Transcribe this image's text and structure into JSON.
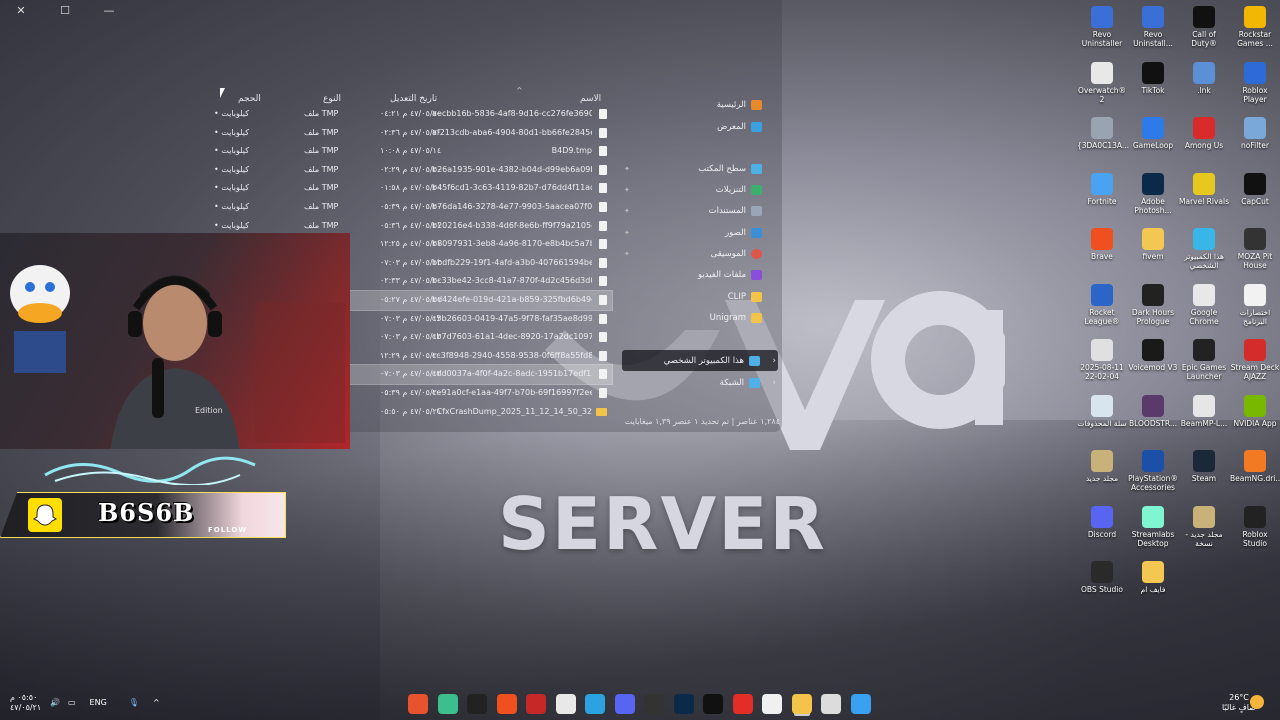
{
  "wallpaper": {
    "server_text": "SERVER"
  },
  "window": {
    "title_buttons": [
      "✕",
      "☐",
      "—"
    ],
    "columns": {
      "size": "الحجم",
      "type": "النوع",
      "date": "تاريخ التعديل",
      "name": "الاسم"
    },
    "files": [
      {
        "size": "• كيلوبايت",
        "type": "ملف TMP",
        "date": "٤٧/٠٥/٢٠ م ٠٤:٢١",
        "name": "aecbb16b-5836-4af8-9d16-cc276fe36900",
        "icon": "file",
        "selected": false
      },
      {
        "size": "• كيلوبايت",
        "type": "ملف TMP",
        "date": "٤٧/٠٥/٢٠ م ٠٢:٣٦",
        "name": "af213cdb-aba6-4904-80d1-bb66fe2845e9....",
        "icon": "file",
        "selected": false
      },
      {
        "size": "• كيلوبايت",
        "type": "ملف TMP",
        "date": "٤٧/٠٥/١٤ م ١٠:٠٨",
        "name": "B4D9.tmp",
        "icon": "file",
        "selected": false
      },
      {
        "size": "• كيلوبايت",
        "type": "ملف TMP",
        "date": "٤٧/٠٥/٢٠ م ٠٢:٢٩",
        "name": "b26a1935-901e-4382-b04d-d99eb6a09b3...",
        "icon": "file",
        "selected": false
      },
      {
        "size": "• كيلوبايت",
        "type": "ملف TMP",
        "date": "٤٧/٠٥/٢٠ م ٠١:٥٨",
        "name": "b45f6cd1-3c63-4119-82b7-d76dd4f11ade...",
        "icon": "file",
        "selected": false
      },
      {
        "size": "• كيلوبايت",
        "type": "ملف TMP",
        "date": "٤٧/٠٥/٢٠ م ٠٥:٣٩",
        "name": "b76da146-3278-4e77-9903-5aacea07f07b...",
        "icon": "file",
        "selected": false
      },
      {
        "size": "• كيلوبايت",
        "type": "ملف TMP",
        "date": "٤٧/٠٥/٢١ م ٠٥:٣٦",
        "name": "b20216e4-b338-4d6f-8e6b-ff9f79a21054.t...",
        "icon": "file",
        "selected": false
      },
      {
        "size": "",
        "type": "",
        "date": "٤٧/٠٥/٢١ م ١٢:٢٥",
        "name": "b8097931-3eb8-4a96-8170-e8b4bc5a7b2...",
        "icon": "file",
        "selected": false
      },
      {
        "size": "",
        "type": "",
        "date": "٤٧/٠٥/١٣ م ٠٧:٠٣",
        "name": "bbdfb229-19f1-4afd-a3b0-407661594be4...",
        "icon": "file",
        "selected": false
      },
      {
        "size": "",
        "type": "",
        "date": "٤٧/٠٥/٢٠ م ٠٢:٣٣",
        "name": "bc33be42-3cc8-41a7-870f-4d2c456d3d01...",
        "icon": "file",
        "selected": false
      },
      {
        "size": "",
        "type": "",
        "date": "٤٧/٠٥/٢١ م ٠٥:٢٧",
        "name": "bd424efe-019d-421a-b859-325fbd6b49c0...",
        "icon": "file",
        "selected": true
      },
      {
        "size": "",
        "type": "",
        "date": "٤٧/٠٥/١٣ م ٠٧:٠٣",
        "name": "c5b26603-0419-47a5-9f78-faf35ae8d996.t...",
        "icon": "file",
        "selected": false
      },
      {
        "size": "",
        "type": "",
        "date": "٤٧/٠٥/١٣ م ٠٧:٠٣",
        "name": "cb7d7603-61a1-4dec-8920-17a2dc109785...",
        "icon": "file",
        "selected": false
      },
      {
        "size": "",
        "type": "",
        "date": "٤٧/٠٥/٢٠ م ١٢:٢٩",
        "name": "cc3f8948-2940-4558-9538-0f6ff8a55fd8.t...",
        "icon": "file",
        "selected": false
      },
      {
        "size": "",
        "type": "",
        "date": "٤٧/٠٥/١٣ م ٠٧:٠٣",
        "name": "cdd0037a-4f0f-4a2c-8adc-1951b17edf13....",
        "icon": "file",
        "selected": true
      },
      {
        "size": "",
        "type": "",
        "date": "٤٧/٠٥/٢٠ م ٠٥:٣٩",
        "name": "ce91a0cf-e1aa-49f7-b70b-69f16997f2ee.t...",
        "icon": "file",
        "selected": false
      },
      {
        "size": "",
        "type": "",
        "date": "٤٧/٠٥/٢١ م ٠٥:٥٠",
        "name": "CfxCrashDump_2025_11_12_14_50_32",
        "icon": "folder",
        "selected": false
      }
    ],
    "nav": {
      "home": "الرئيسية",
      "gallery": "المعرض",
      "desktop": "سطح المكتب",
      "downloads": "التنزيلات",
      "documents": "المستندات",
      "pictures": "الصور",
      "music": "الموسيقى",
      "videos": "ملفات الفيديو",
      "clip": "CLIP",
      "unigram": "Unigram",
      "this_pc": "هذا الكمبيوتر الشخصي",
      "network": "الشبكة"
    },
    "status": "١,٢٨٤ عناصر  |  تم تحديد ١ عنصر ١,٣٩ ميغابايت"
  },
  "overlay": {
    "webcam_shirt": "Edition",
    "snap_handle": "B6S6B",
    "follow_label": "FOLLOW"
  },
  "desktop_icons": [
    {
      "label": "Revo Uninstaller",
      "color": "#3a6fd8"
    },
    {
      "label": "Revo Uninstall...",
      "color": "#3a6fd8"
    },
    {
      "label": "Call of Duty®",
      "color": "#111111"
    },
    {
      "label": "Rockstar Games ...",
      "color": "#f2b705"
    },
    {
      "label": "Overwatch® 2",
      "color": "#e8e8e8"
    },
    {
      "label": "TikTok",
      "color": "#111111"
    },
    {
      "label": ".lnk",
      "color": "#5b8fd6"
    },
    {
      "label": "Roblox Player",
      "color": "#2f6bd8"
    },
    {
      "label": "{3DA0C13A...",
      "color": "#9aa4b0"
    },
    {
      "label": "GameLoop",
      "color": "#2d7be8"
    },
    {
      "label": "Among Us",
      "color": "#d92b2b"
    },
    {
      "label": "noFilter",
      "color": "#7aa8d8"
    },
    {
      "label": "Fortnite",
      "color": "#4aa3f0"
    },
    {
      "label": "Adobe Photosh...",
      "color": "#0b2a4a"
    },
    {
      "label": "Marvel Rivals",
      "color": "#e6c81e"
    },
    {
      "label": "CapCut",
      "color": "#111111"
    },
    {
      "label": "Brave",
      "color": "#f04f1f"
    },
    {
      "label": "fivem",
      "color": "#f4c752"
    },
    {
      "label": "هذا الكمبيوتر الشخصي",
      "color": "#38b6e8"
    },
    {
      "label": "MOZA Pit House",
      "color": "#333333"
    },
    {
      "label": "Rocket League®",
      "color": "#2b65c8"
    },
    {
      "label": "Dark Hours Prologue",
      "color": "#222222"
    },
    {
      "label": "Google Chrome",
      "color": "#e8e8e8"
    },
    {
      "label": "اختصارات البرنامج",
      "color": "#f2f2f2"
    },
    {
      "label": "2025-08-11 22-02-04",
      "color": "#e0e0e0"
    },
    {
      "label": "Voicemod V3",
      "color": "#1a1a1a"
    },
    {
      "label": "Epic Games Launcher",
      "color": "#222222"
    },
    {
      "label": "Stream Deck AJAZZ",
      "color": "#d42b2b"
    },
    {
      "label": "سلة المحذوفات",
      "color": "#d8e4ee"
    },
    {
      "label": "BLOODSTR...",
      "color": "#5a3a6a"
    },
    {
      "label": "BeamMP-L...",
      "color": "#e6e6e6"
    },
    {
      "label": "NVIDIA App",
      "color": "#77b900"
    },
    {
      "label": "مجلد جديد",
      "color": "#c9b27a"
    },
    {
      "label": "PlayStation® Accessories",
      "color": "#1b4fa8"
    },
    {
      "label": "Steam",
      "color": "#1b2838"
    },
    {
      "label": "BeamNG.dri...",
      "color": "#f27a22"
    },
    {
      "label": "Discord",
      "color": "#5865f2"
    },
    {
      "label": "Streamlabs Desktop",
      "color": "#80f5d2"
    },
    {
      "label": "مجلد جديد - نسخة",
      "color": "#c9b27a"
    },
    {
      "label": "Roblox Studio",
      "color": "#222222"
    },
    {
      "label": "OBS Studio",
      "color": "#2a2a2a"
    },
    {
      "label": "فايف ام",
      "color": "#f4c752"
    }
  ],
  "taskbar": {
    "clock_time": "٠٥:٥٠ م",
    "clock_date": "٤٧/٠٥/٢١",
    "lang": "ENG",
    "weather_temp": "26°C",
    "weather_desc": "صافٍ غالبًا",
    "apps": [
      {
        "name": "red-x-app",
        "color": "#e8532d"
      },
      {
        "name": "green-app",
        "color": "#3bbf8c"
      },
      {
        "name": "terminal-app",
        "color": "#222222"
      },
      {
        "name": "brave-app",
        "color": "#f04f1f"
      },
      {
        "name": "red-triangle-app",
        "color": "#c62828"
      },
      {
        "name": "chrome-app",
        "color": "#e8e8e8"
      },
      {
        "name": "telegram-app",
        "color": "#2aa3e0"
      },
      {
        "name": "discord-app",
        "color": "#5865f2"
      },
      {
        "name": "dark-app",
        "color": "#333333"
      },
      {
        "name": "photoshop-app",
        "color": "#0b2a4a"
      },
      {
        "name": "capcut-app",
        "color": "#111111"
      },
      {
        "name": "youtube-app",
        "color": "#e52d27"
      },
      {
        "name": "store-app",
        "color": "#f0f0f0"
      },
      {
        "name": "explorer-app",
        "color": "#f3c34a"
      },
      {
        "name": "notepad-app",
        "color": "#dcdcdc"
      },
      {
        "name": "start-app",
        "color": "#3aa0f0"
      }
    ]
  }
}
